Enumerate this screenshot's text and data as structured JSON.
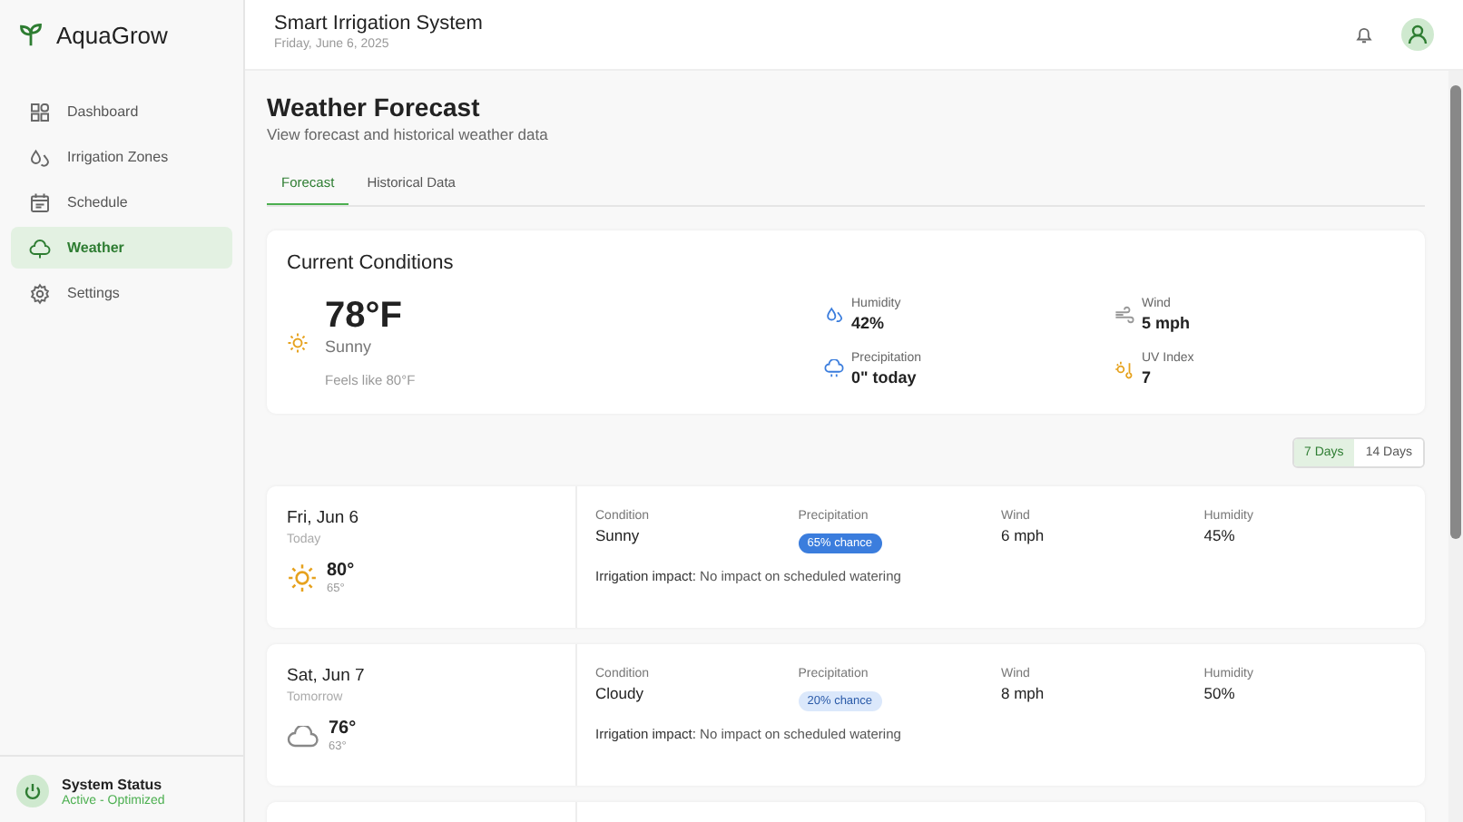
{
  "brand": "AquaGrow",
  "sidebar": {
    "items": [
      {
        "label": "Dashboard",
        "kind": "grid",
        "selected": false
      },
      {
        "label": "Irrigation Zones",
        "kind": "drops",
        "selected": false
      },
      {
        "label": "Schedule",
        "kind": "calendar",
        "selected": false
      },
      {
        "label": "Weather",
        "kind": "cloud",
        "selected": true
      },
      {
        "label": "Settings",
        "kind": "gear",
        "selected": false
      }
    ],
    "status": {
      "title": "System Status",
      "value": "Active - Optimized"
    }
  },
  "header": {
    "title": "Smart Irrigation System",
    "date": "Friday, June 6, 2025"
  },
  "page": {
    "title": "Weather Forecast",
    "subtitle": "View forecast and historical weather data"
  },
  "tabs": [
    {
      "label": "Forecast",
      "selected": true
    },
    {
      "label": "Historical Data",
      "selected": false
    }
  ],
  "current": {
    "title": "Current Conditions",
    "temp": "78°F",
    "condition": "Sunny",
    "kind": "sun",
    "feels_like": "Feels like 80°F",
    "metrics": [
      {
        "kind": "humidity",
        "label": "Humidity",
        "value": "42%"
      },
      {
        "kind": "wind",
        "label": "Wind",
        "value": "5 mph"
      },
      {
        "kind": "rain",
        "label": "Precipitation",
        "value": "0\" today"
      },
      {
        "kind": "uv",
        "label": "UV Index",
        "value": "7"
      }
    ]
  },
  "range_toggle": [
    {
      "label": "7 Days",
      "selected": true
    },
    {
      "label": "14 Days",
      "selected": false
    }
  ],
  "forecast": [
    {
      "date": "Fri, Jun 6",
      "relative": "Today",
      "kind": "sun",
      "high": "80°",
      "low": "65°",
      "condition_label": "Condition",
      "condition": "Sunny",
      "precipitation": {
        "label": "Precipitation",
        "value": "65% chance",
        "kind": "heavy"
      },
      "wind_label": "Wind",
      "wind": "6 mph",
      "humidity_label": "Humidity",
      "humidity": "45%",
      "impact_label": "Irrigation impact:",
      "impact": "No impact on scheduled watering"
    },
    {
      "date": "Sat, Jun 7",
      "relative": "Tomorrow",
      "kind": "cloud",
      "high": "76°",
      "low": "63°",
      "condition_label": "Condition",
      "condition": "Cloudy",
      "precipitation": {
        "label": "Precipitation",
        "value": "20% chance",
        "kind": "light"
      },
      "wind_label": "Wind",
      "wind": "8 mph",
      "humidity_label": "Humidity",
      "humidity": "50%",
      "impact_label": "Irrigation impact:",
      "impact": "No impact on scheduled watering"
    }
  ]
}
